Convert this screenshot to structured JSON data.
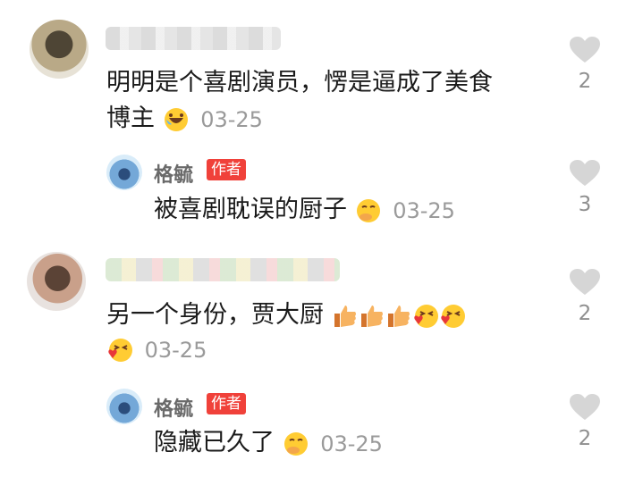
{
  "comments": [
    {
      "text_line1": "明明是个喜剧演员，愣是逼成了美食",
      "text_line2": "博主",
      "emoji": "rofl-emoji",
      "time": "03-25",
      "likes": "2"
    },
    {
      "author": "格毓",
      "badge": "作者",
      "text": "被喜剧耽误的厨子",
      "emoji": "smirk-emoji",
      "time": "03-25",
      "likes": "3"
    },
    {
      "text_line1": "另一个身份，贾大厨",
      "emojis": [
        "thumbs-up-emoji",
        "thumbs-up-emoji",
        "thumbs-up-emoji",
        "kissing-heart-emoji",
        "kissing-heart-emoji",
        "kissing-heart-emoji"
      ],
      "time": "03-25",
      "likes": "2"
    },
    {
      "author": "格毓",
      "badge": "作者",
      "text": "隐藏已久了",
      "emoji": "smirk-emoji",
      "time": "03-25",
      "likes": "2"
    }
  ],
  "colors": {
    "badge": "#f0413a",
    "heart": "#d6d6d6",
    "time": "#9a9a9a"
  }
}
